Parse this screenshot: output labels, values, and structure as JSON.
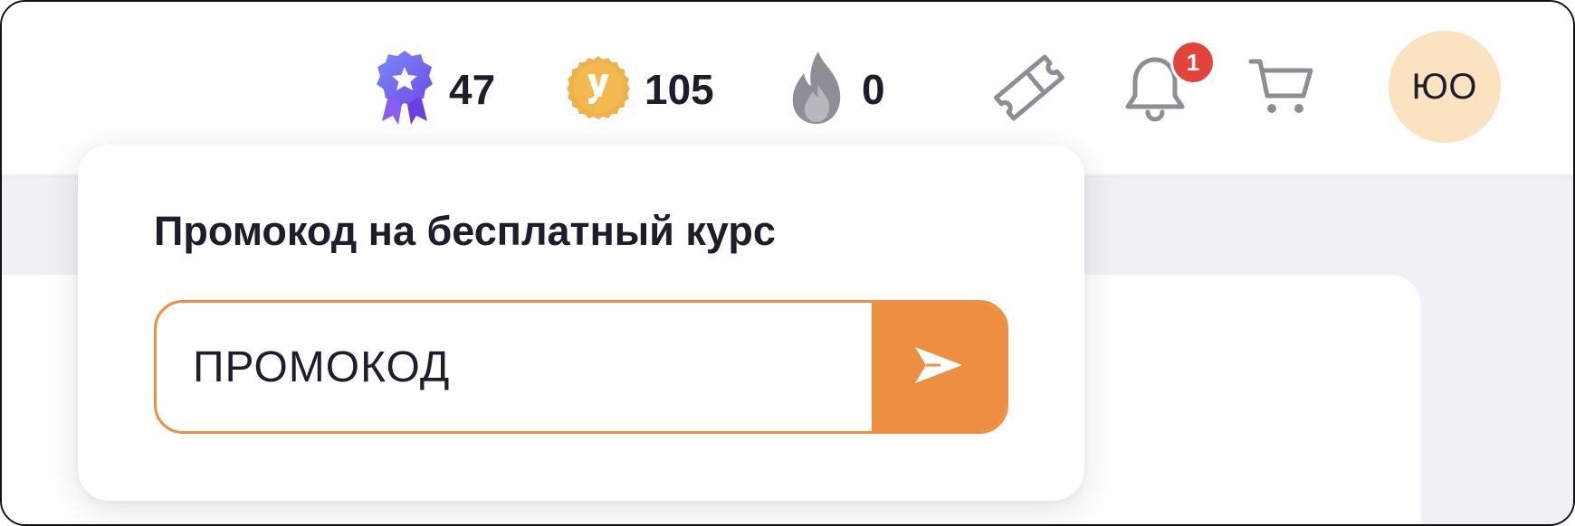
{
  "header": {
    "stats": [
      {
        "name": "awards",
        "icon": "award-badge-icon",
        "value": "47"
      },
      {
        "name": "coins",
        "icon": "coin-icon",
        "value": "105"
      },
      {
        "name": "streak",
        "icon": "flame-icon",
        "value": "0"
      }
    ],
    "notifications_count": "1",
    "avatar_initials": "ЮО"
  },
  "promo_popup": {
    "title": "Промокод на бесплатный курс",
    "input_value": "ПРОМОКОД",
    "input_placeholder": "ПРОМОКОД"
  },
  "colors": {
    "accent": "#ee8e42",
    "badge": "#e0443b",
    "avatar_bg": "#fbe3c1",
    "icon_gray": "#8d8d96"
  }
}
